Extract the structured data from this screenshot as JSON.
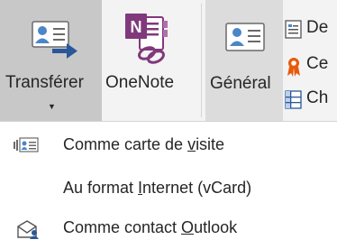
{
  "ribbon": {
    "transfer": {
      "label": "Transférer",
      "icon": "contact-card-forward-icon",
      "has_dropdown": true
    },
    "onenote": {
      "label": "OneNote",
      "icon": "onenote-icon"
    },
    "general": {
      "label": "Général",
      "icon": "contact-card-icon"
    },
    "view_items": [
      {
        "label": "De",
        "icon": "details-icon"
      },
      {
        "label": "Ce",
        "icon": "certificate-icon"
      },
      {
        "label": "Ch",
        "icon": "all-fields-icon"
      }
    ]
  },
  "menu": {
    "items": [
      {
        "prefix": "Comme carte de ",
        "access_key": "v",
        "suffix": "isite",
        "icon": "business-card-icon"
      },
      {
        "prefix": "Au format ",
        "access_key": "I",
        "suffix": "nternet (vCard)",
        "icon": ""
      },
      {
        "prefix": "Comme contact ",
        "access_key": "O",
        "suffix": "utlook",
        "icon": "outlook-contact-icon"
      }
    ]
  },
  "colors": {
    "onenote_purple": "#80397b",
    "accent_blue": "#2b579a",
    "contact_blue": "#4a86c8",
    "pressed_bg": "#c8c8c8",
    "certificate_orange": "#e8590c"
  }
}
